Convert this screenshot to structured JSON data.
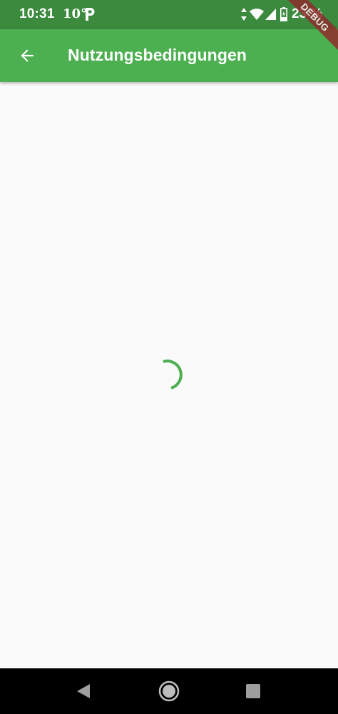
{
  "status_bar": {
    "time": "10:31",
    "weather": "10°",
    "battery": "23 %",
    "icons": [
      "p-icon",
      "data-transfer-icon",
      "wifi-icon",
      "cellular-signal-icon",
      "battery-icon"
    ]
  },
  "app_bar": {
    "title": "Nutzungsbedingungen",
    "back_icon": "arrow-left-icon"
  },
  "debug_banner": {
    "label": "DEBUG"
  },
  "content": {
    "state": "loading",
    "spinner_icon": "circular-progress-icon"
  },
  "nav_bar": {
    "buttons": [
      "back-triangle-icon",
      "home-circle-icon",
      "recents-square-icon"
    ]
  },
  "colors": {
    "status_bar": "#3b8a3e",
    "app_bar": "#4caf50",
    "background": "#fafafa",
    "spinner": "#4caf50",
    "nav_bar": "#000000",
    "debug_banner": "#8f2d2d"
  }
}
